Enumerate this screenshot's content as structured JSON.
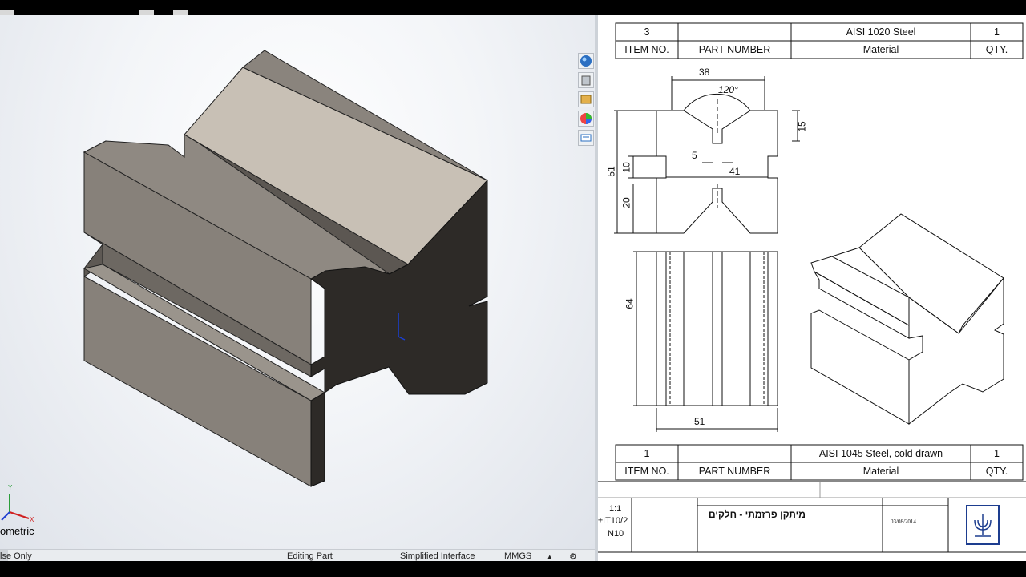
{
  "viewport": {
    "view_label": "ometric",
    "triad": {
      "y": "Y",
      "x": "X"
    }
  },
  "statusbar": {
    "mode": "lse Only",
    "editing": "Editing Part",
    "interface": "Simplified Interface",
    "units": "MMGS",
    "units_arrow": "▴"
  },
  "heads_up_toolbar": {
    "icons": [
      "view-palette-icon",
      "design-library-icon",
      "file-explorer-icon",
      "appearances-icon",
      "custom-properties-icon"
    ]
  },
  "drawing": {
    "bom_top": {
      "row": {
        "item": "3",
        "part_number": "",
        "material": "AISI 1020 Steel",
        "qty": "1"
      },
      "headers": {
        "item": "ITEM NO.",
        "part_number": "PART NUMBER",
        "material": "Material",
        "qty": "QTY."
      }
    },
    "bom_bottom": {
      "row": {
        "item": "1",
        "part_number": "",
        "material": "AISI 1045 Steel, cold drawn",
        "qty": "1"
      },
      "headers": {
        "item": "ITEM NO.",
        "part_number": "PART NUMBER",
        "material": "Material",
        "qty": "QTY."
      }
    },
    "dimensions": {
      "top_width": "38",
      "angle": "120°",
      "v_depth": "15",
      "slot_width": "5",
      "overall_height": "51",
      "groove_height": "10",
      "lower_height": "20",
      "groove_span": "41",
      "length": "64",
      "bottom_width": "51"
    },
    "title_block": {
      "scale": "1:1",
      "tolerance": "±IT10/2",
      "finish": "N10",
      "title": "מיתקן פרזמתי - חלקים",
      "date": "03/08/2014"
    }
  },
  "colors": {
    "model_top": "#c8c0b5",
    "model_side": "#87817a",
    "model_dark": "#2d2a27",
    "sheet_line": "#111111"
  }
}
